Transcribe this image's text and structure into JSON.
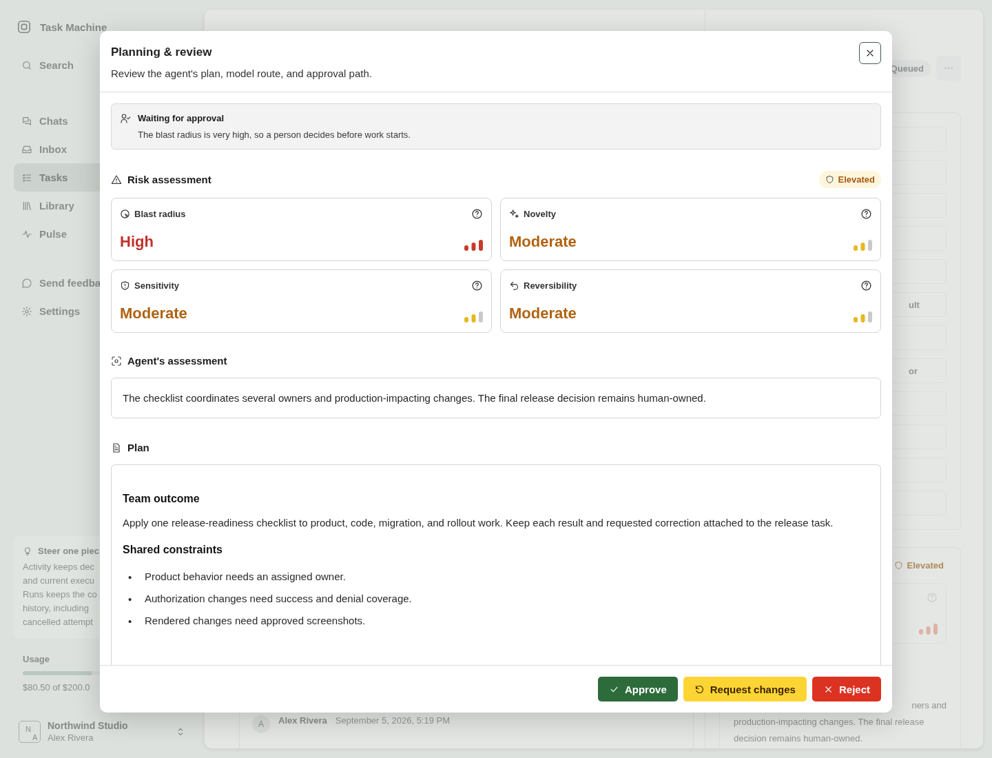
{
  "sidebar": {
    "app_name": "Task Machine",
    "search": {
      "label": "Search"
    },
    "nav_items": [
      {
        "label": "Chats",
        "kind": "chats",
        "selected": false
      },
      {
        "label": "Inbox",
        "kind": "inbox",
        "selected": false
      },
      {
        "label": "Tasks",
        "kind": "tasks",
        "selected": true
      },
      {
        "label": "Library",
        "kind": "library",
        "selected": false
      },
      {
        "label": "Pulse",
        "kind": "pulse",
        "selected": false
      }
    ],
    "secondary_items": [
      {
        "label": "Send feedba",
        "kind": "feedback"
      },
      {
        "label": "Settings",
        "kind": "settings"
      }
    ],
    "tip": {
      "title": "Steer one piec",
      "lines": [
        "Activity keeps dec",
        "and current execu",
        "Runs keeps the co",
        "history, including",
        "cancelled attempt"
      ]
    },
    "usage": {
      "label": "Usage",
      "level": 0.4,
      "reading": "$80.50 of $200.0"
    },
    "workspace": {
      "initials": [
        "N",
        "A"
      ],
      "name": "Northwind Studio",
      "user": "Alex Rivera"
    }
  },
  "background": {
    "status": "Queued",
    "rows": [
      "",
      "",
      "",
      "",
      "",
      "ult",
      "",
      "or",
      "",
      "",
      "",
      ""
    ],
    "risk_badge": "Elevated",
    "summary": [
      "ners and",
      "production-impacting changes. The final release",
      "decision remains human-owned."
    ],
    "comment": {
      "avatar": "A",
      "author": "Alex Rivera",
      "time": "September 5, 2026, 5:19 PM"
    }
  },
  "dialog": {
    "title": "Planning & review",
    "subtitle": "Review the agent's plan, model route, and approval path.",
    "notice": {
      "title": "Waiting for approval",
      "text": "The blast radius is very high, so a person decides before work starts."
    },
    "risk": {
      "heading": "Risk assessment",
      "badge": "Elevated",
      "cards": [
        {
          "kind": "blast",
          "label": "Blast radius",
          "value": "High",
          "level": 1
        },
        {
          "kind": "novelty",
          "label": "Novelty",
          "value": "Moderate",
          "level": 0.67
        },
        {
          "kind": "sensitivity",
          "label": "Sensitivity",
          "value": "Moderate",
          "level": 0.67
        },
        {
          "kind": "reversibility",
          "label": "Reversibility",
          "value": "Moderate",
          "level": 0.67
        }
      ]
    },
    "assessment": {
      "heading": "Agent's assessment",
      "text": "The checklist coordinates several owners and production-impacting changes. The final release decision remains human-owned."
    },
    "plan": {
      "heading": "Plan",
      "blocks": [
        {
          "kind": "heading",
          "text": "Team outcome"
        },
        {
          "kind": "paragraph",
          "text": "Apply one release-readiness checklist to product, code, migration, and rollout work. Keep each result and requested correction attached to the release task."
        },
        {
          "kind": "heading",
          "text": "Shared constraints"
        },
        {
          "kind": "bullets",
          "marker": "•",
          "items": [
            "Product behavior needs an assigned owner.",
            "Authorization changes need success and denial coverage.",
            "Rendered changes need approved screenshots."
          ]
        }
      ]
    },
    "actions": [
      {
        "label": "Approve",
        "kind": "approve"
      },
      {
        "label": "Request changes",
        "kind": "request"
      },
      {
        "label": "Reject",
        "kind": "reject"
      }
    ]
  }
}
